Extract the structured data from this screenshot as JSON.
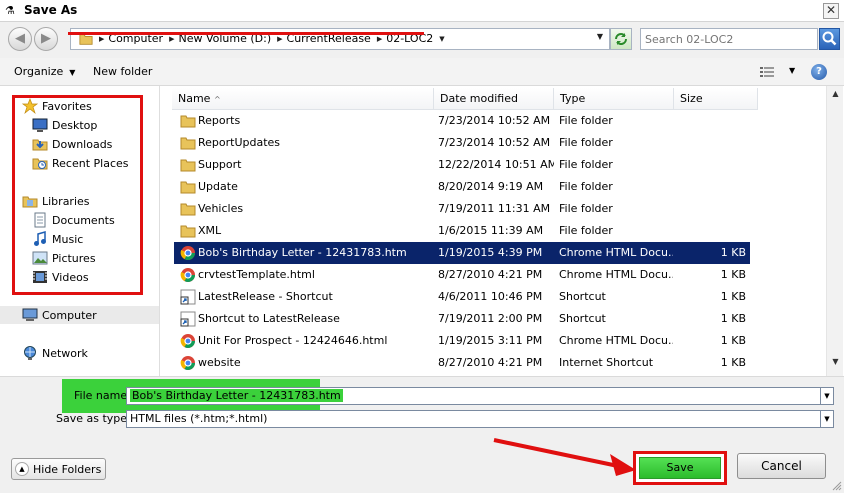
{
  "window": {
    "title": "Save As",
    "close_glyph": "✕"
  },
  "address": {
    "crumbs": [
      "Computer",
      "New Volume (D:)",
      "CurrentRelease",
      "02-LOC2"
    ],
    "search_placeholder": "Search 02-LOC2"
  },
  "toolbar": {
    "organize_label": "Organize",
    "new_folder_label": "New folder",
    "help_glyph": "?"
  },
  "nav": {
    "favorites_label": "Favorites",
    "favorites": [
      "Desktop",
      "Downloads",
      "Recent Places"
    ],
    "libraries_label": "Libraries",
    "libraries": [
      "Documents",
      "Music",
      "Pictures",
      "Videos"
    ],
    "computer_label": "Computer",
    "network_label": "Network"
  },
  "columns": [
    "Name",
    "Date modified",
    "Type",
    "Size"
  ],
  "files": [
    {
      "name": "Reports",
      "date": "7/23/2014 10:52 AM",
      "type": "File folder",
      "size": "",
      "icon": "folder-icon"
    },
    {
      "name": "ReportUpdates",
      "date": "7/23/2014 10:52 AM",
      "type": "File folder",
      "size": "",
      "icon": "folder-icon"
    },
    {
      "name": "Support",
      "date": "12/22/2014 10:51 AM",
      "type": "File folder",
      "size": "",
      "icon": "folder-icon"
    },
    {
      "name": "Update",
      "date": "8/20/2014 9:19 AM",
      "type": "File folder",
      "size": "",
      "icon": "folder-icon"
    },
    {
      "name": "Vehicles",
      "date": "7/19/2011 11:31 AM",
      "type": "File folder",
      "size": "",
      "icon": "folder-icon"
    },
    {
      "name": "XML",
      "date": "1/6/2015 11:39 AM",
      "type": "File folder",
      "size": "",
      "icon": "folder-icon"
    },
    {
      "name": "Bob's Birthday Letter - 12431783.htm",
      "date": "1/19/2015 4:39 PM",
      "type": "Chrome HTML Docu...",
      "size": "1 KB",
      "icon": "chrome-icon",
      "selected": true
    },
    {
      "name": "crvtestTemplate.html",
      "date": "8/27/2010 4:21 PM",
      "type": "Chrome HTML Docu...",
      "size": "1 KB",
      "icon": "chrome-icon"
    },
    {
      "name": "LatestRelease - Shortcut",
      "date": "4/6/2011 10:46 PM",
      "type": "Shortcut",
      "size": "1 KB",
      "icon": "shortcut-icon"
    },
    {
      "name": "Shortcut to LatestRelease",
      "date": "7/19/2011 2:00 PM",
      "type": "Shortcut",
      "size": "1 KB",
      "icon": "shortcut-icon"
    },
    {
      "name": "Unit For Prospect - 12424646.html",
      "date": "1/19/2015 3:11 PM",
      "type": "Chrome HTML Docu...",
      "size": "1 KB",
      "icon": "chrome-icon"
    },
    {
      "name": "website",
      "date": "8/27/2010 4:21 PM",
      "type": "Internet Shortcut",
      "size": "1 KB",
      "icon": "internet-shortcut-icon"
    }
  ],
  "form": {
    "filename_label": "File name:",
    "filename_value": "Bob's Birthday Letter - 12431783.htm",
    "savetype_label": "Save as type:",
    "savetype_value": "HTML files (*.htm;*.html)",
    "hide_folders_label": "Hide Folders",
    "save_label": "Save",
    "cancel_label": "Cancel"
  },
  "colors": {
    "annotation_red": "#e01010",
    "highlight_green": "#3bd13b",
    "selection_blue": "#0a246a"
  }
}
